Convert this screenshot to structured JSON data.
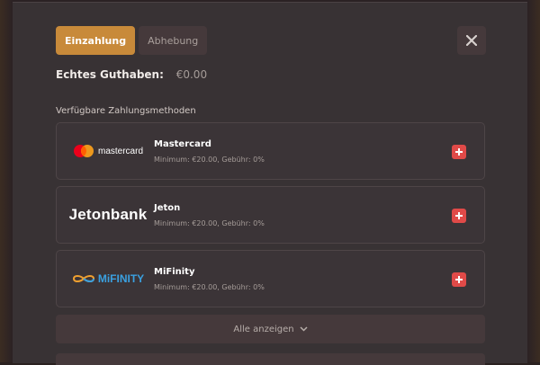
{
  "tabs": [
    {
      "label": "Einzahlung",
      "active": true
    },
    {
      "label": "Abhebung",
      "active": false
    }
  ],
  "balance": {
    "label": "Echtes Guthaben:",
    "value": "€0.00"
  },
  "section_title": "Verfügbare Zahlungsmethoden",
  "methods": [
    {
      "name": "Mastercard",
      "details": "Minimum: €20.00, Gebühr: 0%",
      "logo_text": "mastercard",
      "icon": "mastercard-logo"
    },
    {
      "name": "Jeton",
      "details": "Minimum: €20.00, Gebühr: 0%",
      "logo_text": "Jetonbank",
      "icon": "jetonbank-logo"
    },
    {
      "name": "MiFinity",
      "details": "Minimum: €20.00, Gebühr: 0%",
      "logo_text": "MiFINITY",
      "icon": "mifinity-logo"
    }
  ],
  "show_all": {
    "label": "Alle anzeigen",
    "icon": "chevron-down-icon"
  },
  "colors": {
    "accent": "#c88a3a",
    "add_button": "#e04a48",
    "background": "#383234"
  }
}
